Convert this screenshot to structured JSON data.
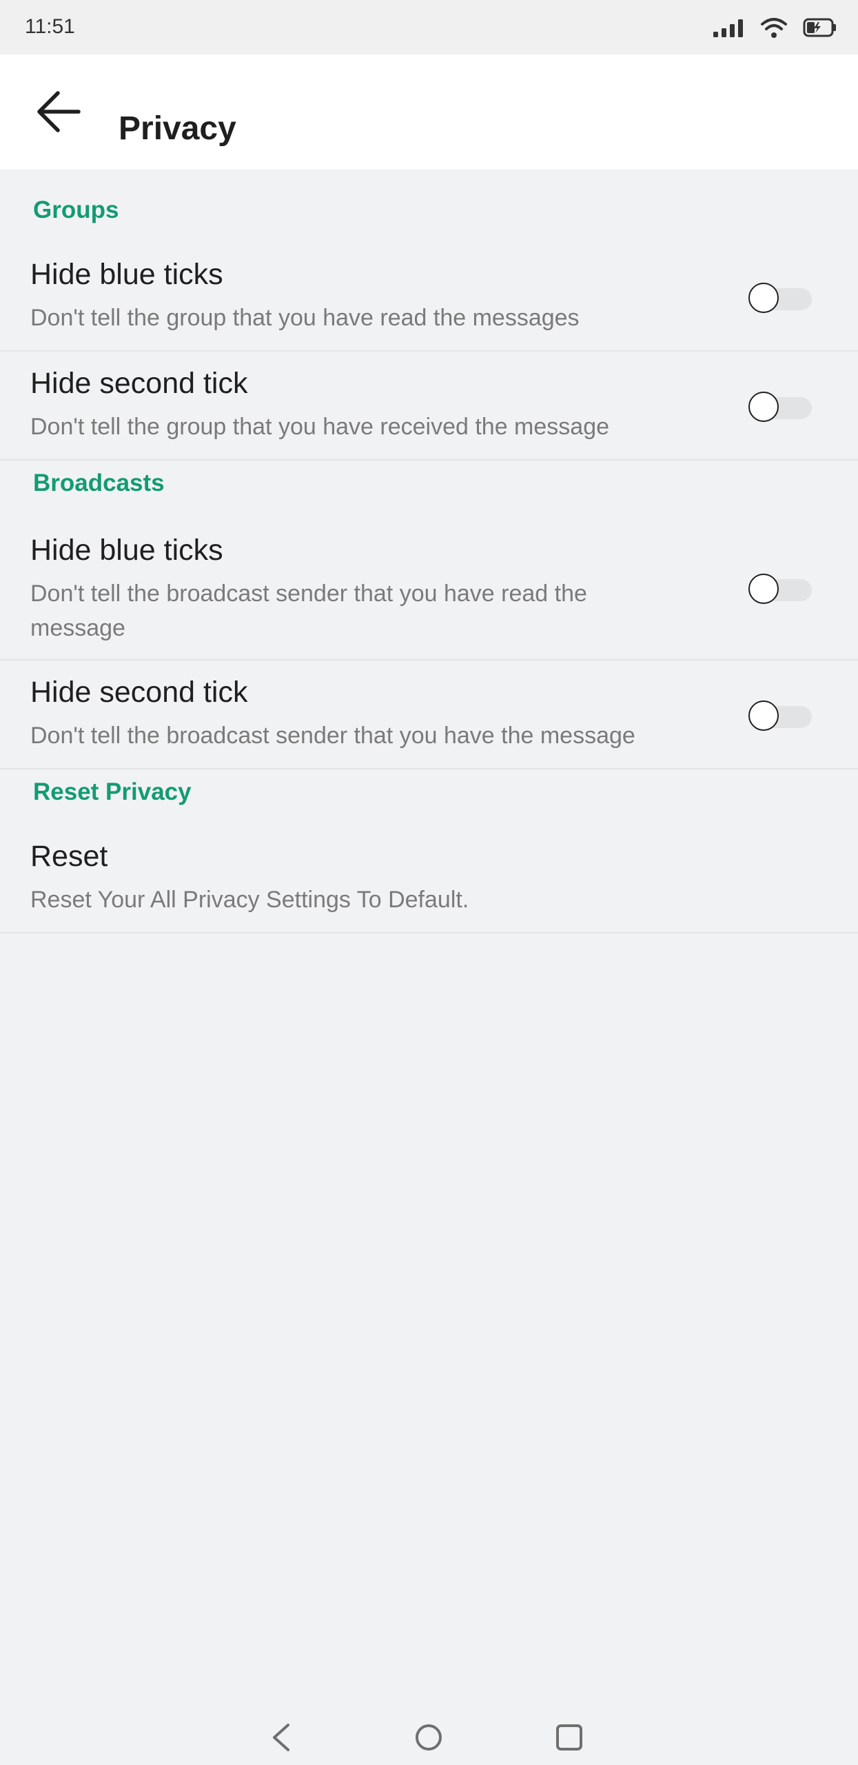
{
  "status_bar": {
    "time": "11:51",
    "icons": [
      "signal-icon",
      "wifi-icon",
      "battery-icon"
    ]
  },
  "header": {
    "title": "Privacy",
    "back_icon": "arrow-left-icon"
  },
  "sections": [
    {
      "header": "Groups",
      "items": [
        {
          "title": "Hide blue ticks",
          "subtitle": "Don't tell the group that you have read the messages",
          "toggle_on": false
        },
        {
          "title": "Hide second tick",
          "subtitle": "Don't tell the group that you have received the message",
          "toggle_on": false
        }
      ]
    },
    {
      "header": "Broadcasts",
      "items": [
        {
          "title": "Hide blue ticks",
          "subtitle": "Don't tell the broadcast sender that you have read the message",
          "toggle_on": false
        },
        {
          "title": "Hide second tick",
          "subtitle": "Don't tell the broadcast sender that you have the message",
          "toggle_on": false
        }
      ]
    },
    {
      "header": "Reset Privacy",
      "items": [
        {
          "title": "Reset",
          "subtitle": "Reset Your All Privacy Settings To Default."
        }
      ]
    }
  ],
  "nav_bar": {
    "icons": [
      "back-triangle-icon",
      "home-circle-icon",
      "recents-square-icon"
    ]
  },
  "colors": {
    "accent": "#139b72",
    "background": "#f1f2f4",
    "toggle_track_off": "#e2e3e5"
  }
}
